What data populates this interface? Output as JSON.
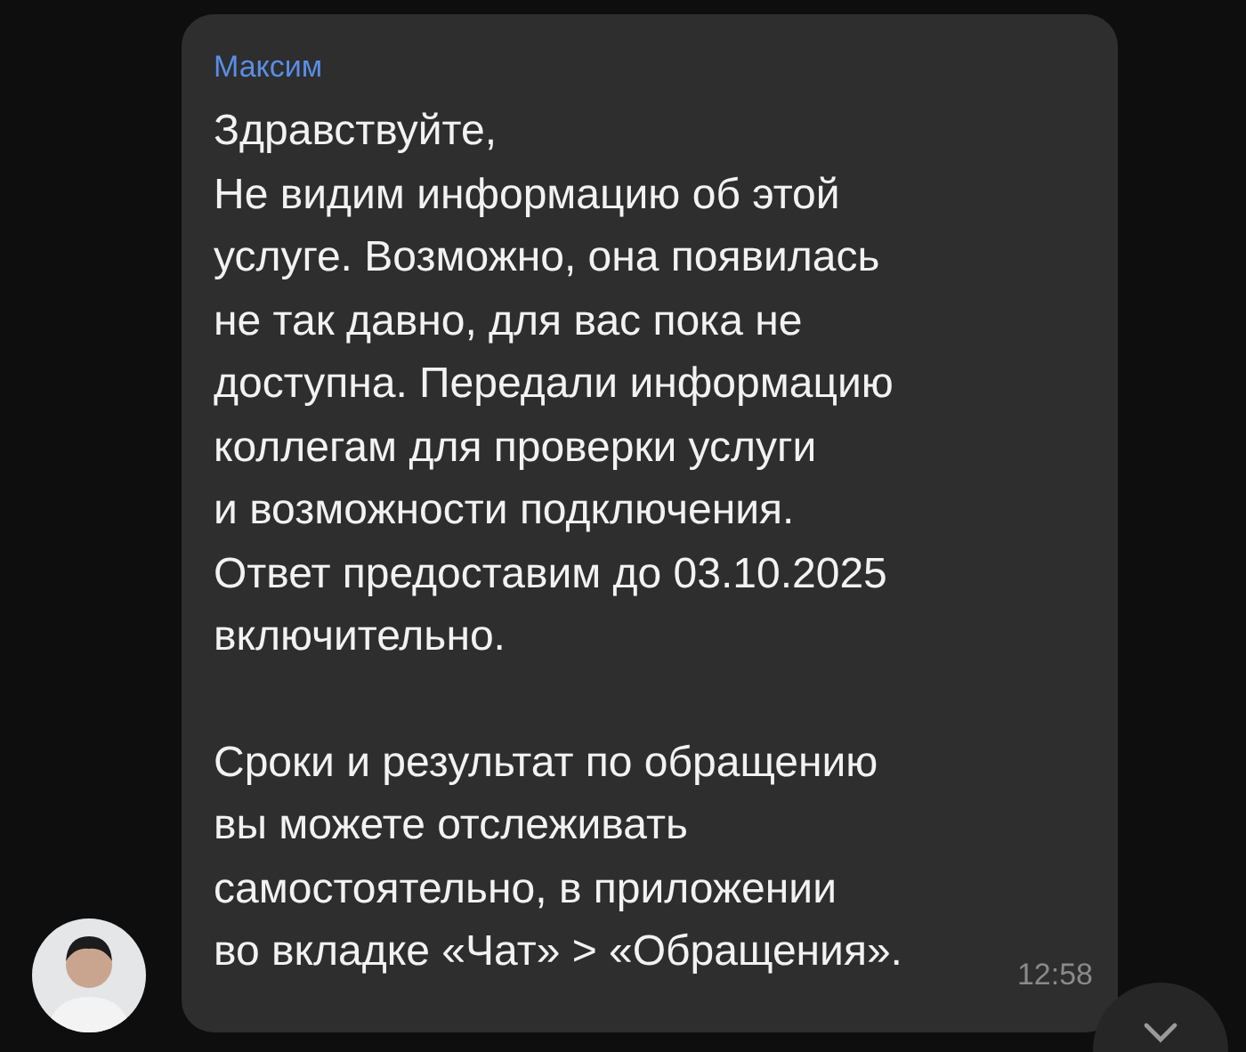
{
  "message": {
    "sender": "Максим",
    "paragraphs": [
      "Здравствуйте,\nНе видим информацию об этой\nуслуге. Возможно, она появилась\nне так давно, для вас пока не\nдоступна. Передали информацию\nколлегам для проверки услуги\nи возможности подключения.\nОтвет предоставим до 03.10.2025\nвключительно.",
      "Сроки и результат по обращению\nвы можете отслеживать\nсамостоятельно, в приложении\nво вкладке «Чат» > «Обращения»."
    ],
    "time": "12:58"
  }
}
